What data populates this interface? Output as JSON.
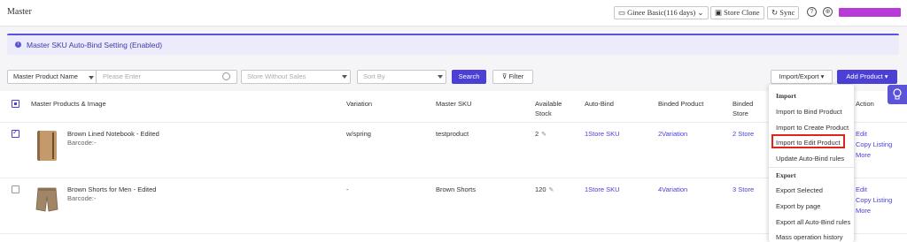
{
  "topbar": {
    "title": "Master",
    "plan": "Ginee Basic(116 days)",
    "store_clone": "Store Clone",
    "sync": "Sync",
    "help_icon": "question-icon",
    "globe_icon": "globe-icon"
  },
  "banner": {
    "text": "Master SKU Auto-Bind Setting (Enabled)"
  },
  "filters": {
    "search_by": "Master Product Name",
    "search_placeholder": "Please Enter",
    "store_filter": "Store Without Sales",
    "sort_by": "Sort By",
    "search_button": "Search",
    "filter_button": "Filter",
    "import_export_button": "Import/Export",
    "add_product_button": "Add Product"
  },
  "table": {
    "headers": {
      "product": "Master Products & Image",
      "variation": "Variation",
      "sku": "Master SKU",
      "stock_line1": "Available",
      "stock_line2": "Stock",
      "auto_bind": "Auto-Bind",
      "binded_product": "Binded Product",
      "binded_store_line1": "Binded",
      "binded_store_line2": "Store",
      "action": "Action"
    },
    "rows": [
      {
        "name": "Brown Lined Notebook - Edited",
        "barcode": "Barcode:-",
        "variation": "w/spring",
        "sku": "testproduct",
        "stock": "2",
        "auto_bind": "1Store SKU",
        "binded_product": "2Variation",
        "binded_store": "2 Store",
        "action_edit": "Edit",
        "action_copy": "Copy Listing",
        "action_more": "More"
      },
      {
        "name": "Brown Shorts for Men - Edited",
        "barcode": "Barcode:-",
        "variation": "-",
        "sku": "Brown Shorts",
        "stock": "120",
        "auto_bind": "1Store SKU",
        "binded_product": "4Variation",
        "binded_store": "3 Store",
        "action_edit": "Edit",
        "action_copy": "Copy Listing",
        "action_more": "More"
      }
    ]
  },
  "dropdown": {
    "import_header": "Import",
    "import_bind": "Import to Bind Product",
    "import_create": "Import to Create Product",
    "import_edit": "Import to Edit Product",
    "update_rules": "Update Auto-Bind rules",
    "export_header": "Export",
    "export_selected": "Export Selected",
    "export_page": "Export by page",
    "export_rules": "Export all Auto-Bind rules",
    "mass_history": "Mass operation history"
  },
  "colors": {
    "accent": "#4b3fd6",
    "banner_bg": "#ecebfb",
    "highlight": "#e0241b"
  }
}
